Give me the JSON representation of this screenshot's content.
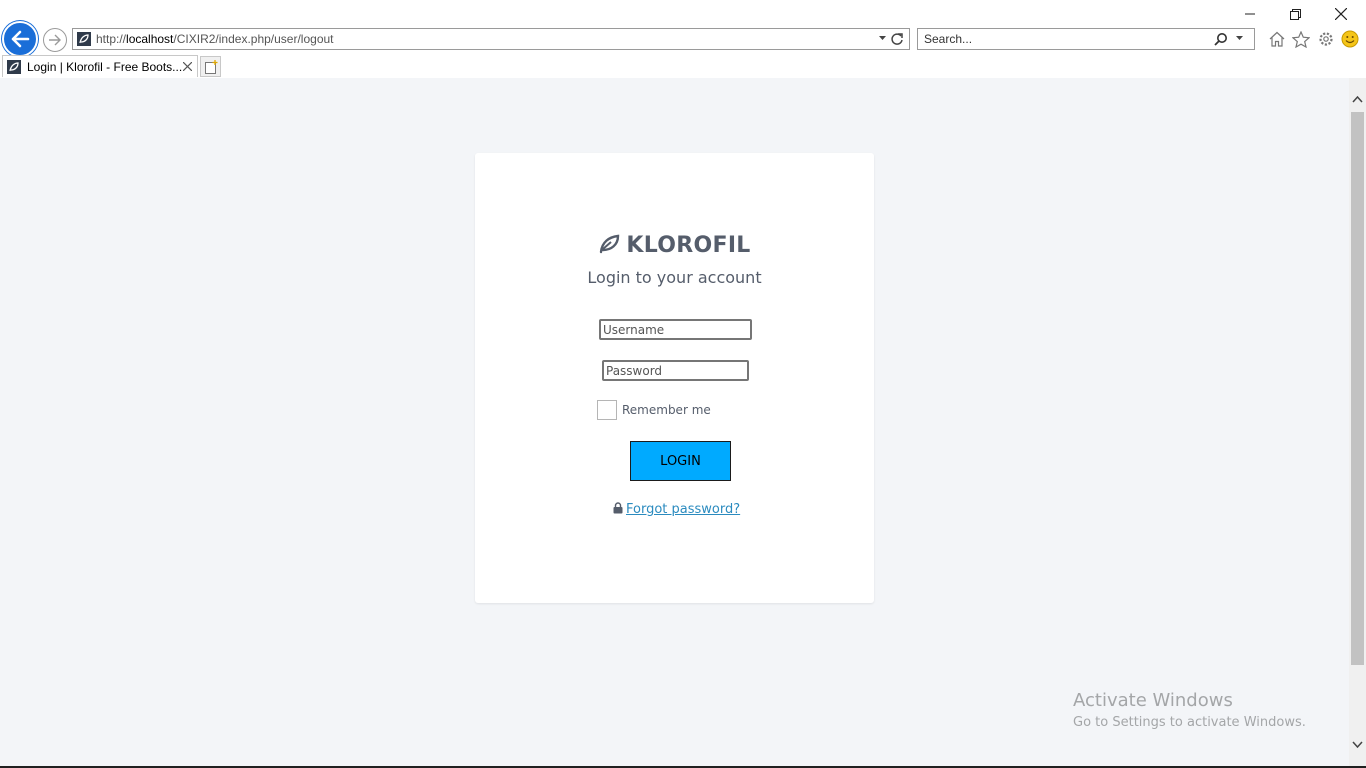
{
  "browser": {
    "address": {
      "url_prefix": "http://",
      "url_host": "localhost",
      "url_path": "/CIXIR2/index.php/user/logout"
    },
    "search": {
      "placeholder": "Search..."
    },
    "tabs": [
      {
        "title": "Login | Klorofil - Free Boots..."
      }
    ],
    "icons": {
      "back": "back-arrow-icon",
      "forward": "forward-arrow-icon",
      "home": "home-icon",
      "favorites": "star-icon",
      "settings": "gear-icon",
      "feedback": "smiley-icon",
      "close_tab": "close-icon",
      "new_tab": "new-tab-icon"
    },
    "accent_color": "#1a6ed8"
  },
  "login": {
    "brand": "KLOROFIL",
    "subtitle": "Login to your account",
    "username_placeholder": "Username",
    "password_placeholder": "Password",
    "remember_label": "Remember me",
    "login_button": "LOGIN",
    "forgot_link": "Forgot password?",
    "button_color": "#00aaff",
    "link_color": "#2b8bbf"
  },
  "watermark": {
    "title": "Activate Windows",
    "subtitle": "Go to Settings to activate Windows."
  }
}
